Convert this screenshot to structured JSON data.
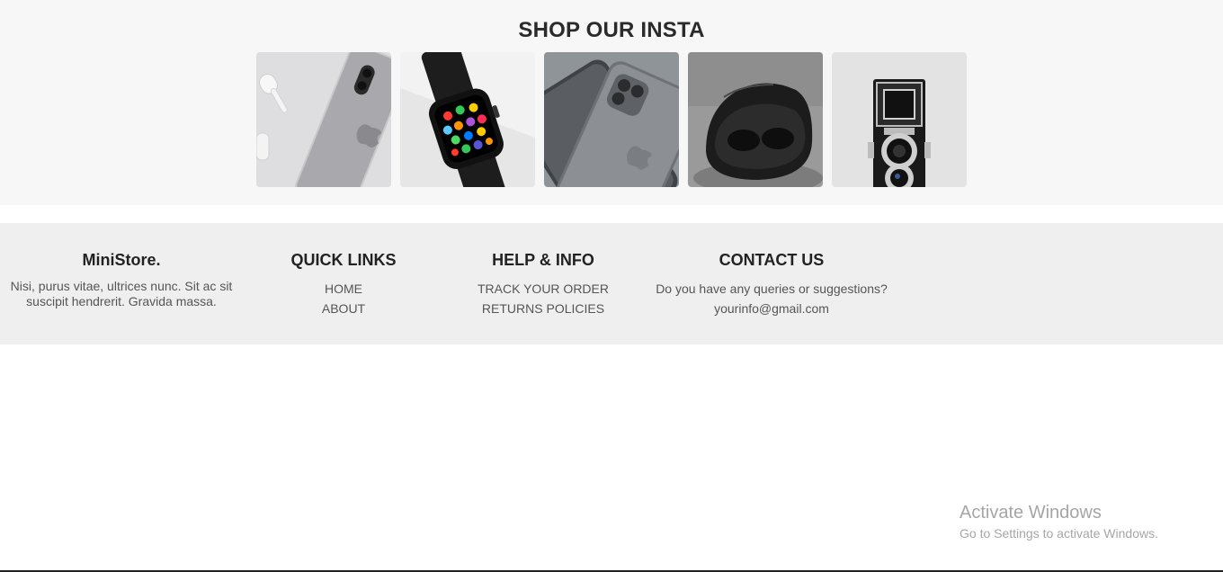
{
  "insta": {
    "title": "SHOP OUR INSTA",
    "images": [
      {
        "icon": "iphone-and-airpods-photo"
      },
      {
        "icon": "smartwatch-photo"
      },
      {
        "icon": "iphone-pro-photo"
      },
      {
        "icon": "earbuds-case-photo"
      },
      {
        "icon": "vintage-camera-photo"
      }
    ]
  },
  "footer": {
    "brand": {
      "title": "MiniStore.",
      "description": "Nisi, purus vitae, ultrices nunc. Sit ac sit suscipit hendrerit. Gravida massa."
    },
    "quick_links": {
      "title": "QUICK LINKS",
      "items": [
        "HOME",
        "ABOUT"
      ]
    },
    "help": {
      "title": "HELP & INFO",
      "items": [
        "TRACK YOUR ORDER",
        "RETURNS POLICIES"
      ]
    },
    "contact": {
      "title": "CONTACT US",
      "question": "Do you have any queries or suggestions?",
      "email": "yourinfo@gmail.com"
    }
  },
  "watermark": {
    "line1": "Activate Windows",
    "line2": "Go to Settings to activate Windows."
  },
  "colors": {
    "insta_bg": "#f7f7f7",
    "footer_bg": "#efefef",
    "heading": "#222222",
    "text": "#555555"
  }
}
